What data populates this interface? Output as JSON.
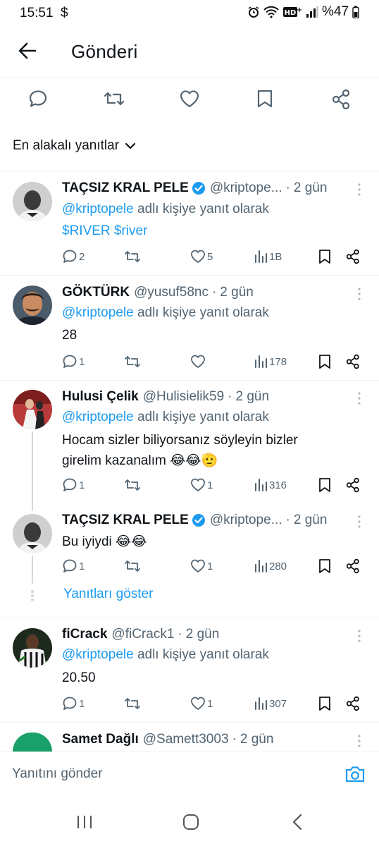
{
  "status_bar": {
    "time": "15:51",
    "dollar": "$",
    "battery": "%47"
  },
  "header": {
    "title": "Gönderi"
  },
  "sort": {
    "label": "En alakalı yanıtlar"
  },
  "reply_prefix": "adlı kişiye yanıt olarak",
  "tweets": [
    {
      "name": "TAÇSIZ KRAL PELE",
      "handle": "@kriptope...",
      "time": "2 gün",
      "reply_to": "@kriptopele",
      "text_links": "$RIVER $river",
      "replies": "2",
      "likes": "5",
      "views": "1B"
    },
    {
      "name": "GÖKTÜRK",
      "handle": "@yusuf58nc",
      "time": "2 gün",
      "reply_to": "@kriptopele",
      "text": "28",
      "replies": "1",
      "likes": "",
      "views": "178"
    },
    {
      "name": "Hulusi Çelik",
      "handle": "@Hulisielik59",
      "time": "2 gün",
      "reply_to": "@kriptopele",
      "text_line1": "Hocam sizler biliyorsanız söyleyin bizler",
      "text_line2": "girelim kazanalım",
      "emoji": "😂😂🫡",
      "replies": "1",
      "likes": "1",
      "views": "316"
    },
    {
      "name": "TAÇSIZ KRAL PELE",
      "handle": "@kriptope...",
      "time": "2 gün",
      "text": "Bu iyiydi",
      "emoji": "😂😂",
      "replies": "1",
      "likes": "1",
      "views": "280"
    },
    {
      "name": "fiCrack",
      "handle": "@fiCrack1",
      "time": "2 gün",
      "reply_to": "@kriptopele",
      "text": "20.50",
      "replies": "1",
      "likes": "1",
      "views": "307"
    },
    {
      "name": "Samet Dağlı",
      "handle": "@Samett3003",
      "time": "2 gün"
    }
  ],
  "show_replies": "Yanıtları göster",
  "reply_bar": {
    "placeholder": "Yanıtını gönder"
  },
  "colors": {
    "accent": "#1d9bf0",
    "secondary_text": "#536471",
    "divider": "#eff3f4"
  }
}
